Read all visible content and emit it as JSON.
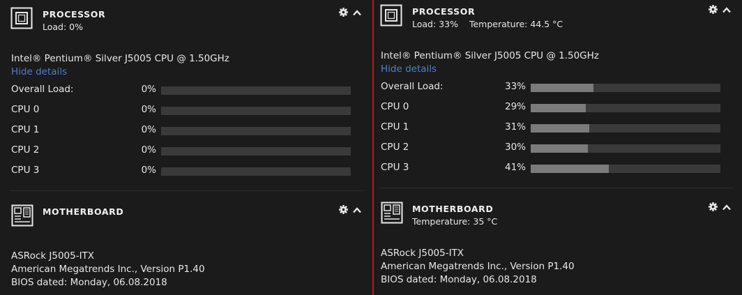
{
  "panels": [
    {
      "processor": {
        "title": "PROCESSOR",
        "load": "Load: 0%",
        "temperature": "",
        "cpu_name": "Intel® Pentium® Silver J5005 CPU @ 1.50GHz",
        "hide_details": "Hide details",
        "rows": [
          {
            "label": "Overall Load:",
            "pct": "0%",
            "value": 0
          },
          {
            "label": "CPU 0",
            "pct": "0%",
            "value": 0
          },
          {
            "label": "CPU 1",
            "pct": "0%",
            "value": 0
          },
          {
            "label": "CPU 2",
            "pct": "0%",
            "value": 0
          },
          {
            "label": "CPU 3",
            "pct": "0%",
            "value": 0
          }
        ]
      },
      "motherboard": {
        "title": "MOTHERBOARD",
        "temperature": "",
        "model": "ASRock J5005-ITX",
        "bios_vendor": "American Megatrends Inc., Version P1.40",
        "bios_date": "BIOS dated: Monday, 06.08.2018"
      }
    },
    {
      "processor": {
        "title": "PROCESSOR",
        "load": "Load: 33%",
        "temperature": "Temperature: 44.5 °C",
        "cpu_name": "Intel® Pentium® Silver J5005 CPU @ 1.50GHz",
        "hide_details": "Hide details",
        "rows": [
          {
            "label": "Overall Load:",
            "pct": "33%",
            "value": 33
          },
          {
            "label": "CPU 0",
            "pct": "29%",
            "value": 29
          },
          {
            "label": "CPU 1",
            "pct": "31%",
            "value": 31
          },
          {
            "label": "CPU 2",
            "pct": "30%",
            "value": 30
          },
          {
            "label": "CPU 3",
            "pct": "41%",
            "value": 41
          }
        ]
      },
      "motherboard": {
        "title": "MOTHERBOARD",
        "temperature": "Temperature: 35 °C",
        "model": "ASRock J5005-ITX",
        "bios_vendor": "American Megatrends Inc., Version P1.40",
        "bios_date": "BIOS dated: Monday, 06.08.2018"
      }
    }
  ],
  "icons": {
    "processor": "cpu-chip-icon",
    "motherboard": "motherboard-icon",
    "settings": "gear-icon",
    "collapse": "chevron-up-icon"
  },
  "colors": {
    "accent_divider": "#c4161c",
    "link": "#4f7fd0",
    "bar_track": "#3a3a3a",
    "bar_fill": "#7b7b7b"
  }
}
